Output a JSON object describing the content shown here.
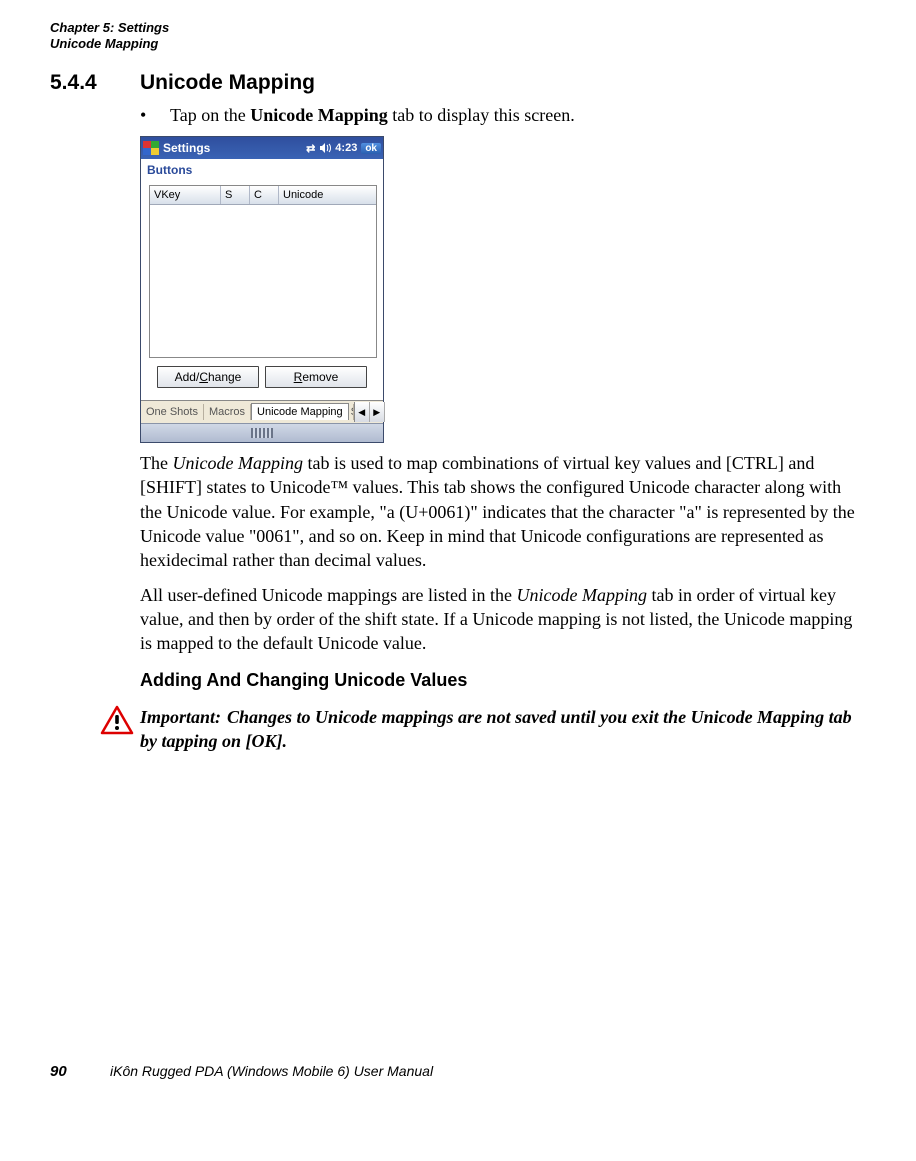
{
  "header": {
    "chapter_line": "Chapter 5: Settings",
    "section_line": "Unicode Mapping"
  },
  "section": {
    "number": "5.4.4",
    "title": "Unicode Mapping"
  },
  "bullet": {
    "pre": "Tap on the ",
    "bold": "Unicode Mapping",
    "post": " tab to display this screen."
  },
  "screenshot": {
    "titlebar": {
      "title": "Settings",
      "time": "4:23",
      "ok": "ok"
    },
    "subtitle": "Buttons",
    "columns": {
      "vkey": "VKey",
      "s": "S",
      "c": "C",
      "unicode": "Unicode"
    },
    "rows": [],
    "buttons": {
      "add_pre": "Add/",
      "add_u": "C",
      "add_post": "hange",
      "rem_u": "R",
      "rem_post": "emove"
    },
    "tabs": {
      "one_shots": "One Shots",
      "macros": "Macros",
      "unicode_mapping": "Unicode Mapping",
      "partial": "S"
    }
  },
  "para1": {
    "t1": "The ",
    "i1": "Unicode Mapping",
    "t2": " tab is used to map combinations of virtual key values and [CTRL] and [SHIFT] states to Unicode™ values. This tab shows the configured Unicode character along with the Unicode value. For example, \"a (U+0061)\" indicates that the character \"a\" is represented by the Unicode value \"0061\", and so on. Keep in mind that Unicode configurations are represented as hexidecimal rather than decimal values."
  },
  "para2": {
    "t1": "All user-defined Unicode mappings are listed in the ",
    "i1": "Unicode Mapping",
    "t2": " tab in order of virtual key value, and then by order of the shift state. If a Unicode mapping is not listed, the Unicode mapping is mapped to the default Unicode value."
  },
  "subheading": "Adding And Changing Unicode Values",
  "important": {
    "label": "Important:",
    "text": "Changes to Unicode mappings are not saved until you exit the Unicode Mapping tab by tapping on [OK]."
  },
  "footer": {
    "page": "90",
    "manual": "iKôn Rugged PDA (Windows Mobile 6) User Manual"
  }
}
